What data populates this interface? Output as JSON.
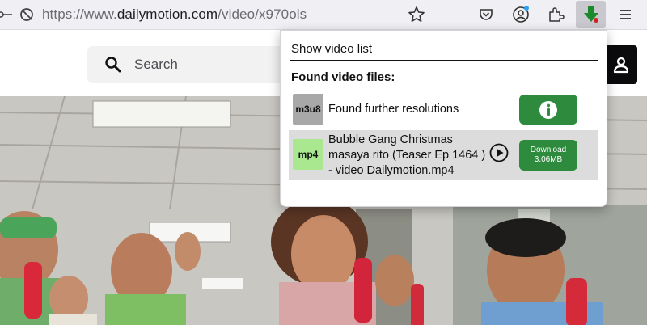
{
  "browser": {
    "url_prefix": "https://www.",
    "url_domain": "dailymotion.com",
    "url_path": "/video/x970ols"
  },
  "site": {
    "search_placeholder": "Search"
  },
  "popup": {
    "show_list_label": "Show video list",
    "found_heading": "Found video files:",
    "items": [
      {
        "badge": "m3u8",
        "title": "Found further resolutions"
      },
      {
        "badge": "mp4",
        "title": "Bubble Gang Christmas masaya rito (Teaser Ep 1464 ) - video Dailymotion.mp4",
        "download_label": "Download",
        "size": "3.06MB"
      }
    ]
  },
  "colors": {
    "accent_green": "#2e8b3e",
    "mp4_badge": "#a9e88f",
    "m3u8_badge": "#a8a8a8"
  }
}
